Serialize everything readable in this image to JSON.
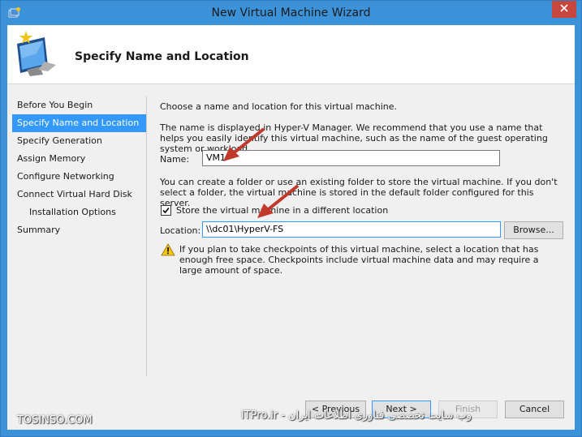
{
  "window": {
    "title": "New Virtual Machine Wizard",
    "header_title": "Specify Name and Location",
    "close_icon": "close-icon"
  },
  "nav": {
    "items": [
      {
        "label": "Before You Begin",
        "active": false,
        "sub": false
      },
      {
        "label": "Specify Name and Location",
        "active": true,
        "sub": false
      },
      {
        "label": "Specify Generation",
        "active": false,
        "sub": false
      },
      {
        "label": "Assign Memory",
        "active": false,
        "sub": false
      },
      {
        "label": "Configure Networking",
        "active": false,
        "sub": false
      },
      {
        "label": "Connect Virtual Hard Disk",
        "active": false,
        "sub": false
      },
      {
        "label": "Installation Options",
        "active": false,
        "sub": true
      },
      {
        "label": "Summary",
        "active": false,
        "sub": false
      }
    ]
  },
  "content": {
    "intro": "Choose a name and location for this virtual machine.",
    "name_help": "The name is displayed in Hyper-V Manager. We recommend that you use a name that helps you easily identify this virtual machine, such as the name of the guest operating system or workload.",
    "name_label": "Name:",
    "name_value": "VM1",
    "folder_help": "You can create a folder or use an existing folder to store the virtual machine. If you don't select a folder, the virtual machine is stored in the default folder configured for this server.",
    "store_checkbox_label": "Store the virtual machine in a different location",
    "store_checked": true,
    "location_label": "Location:",
    "location_value": "\\\\dc01\\HyperV-FS",
    "browse_label": "Browse...",
    "warning_text": "If you plan to take checkpoints of this virtual machine, select a location that has enough free space. Checkpoints include virtual machine data and may require a large amount of space."
  },
  "buttons": {
    "previous": "< Previous",
    "next": "Next >",
    "finish": "Finish",
    "cancel": "Cancel"
  },
  "watermarks": {
    "left": "TOSINSO.COM",
    "right": "وب سایت تخصصی فناوری اطلاعات ایران - ITPro.ir"
  },
  "colors": {
    "frame": "#3c92d8",
    "selection": "#3399ff",
    "close": "#c7463d",
    "arrow": "#c0392b"
  }
}
